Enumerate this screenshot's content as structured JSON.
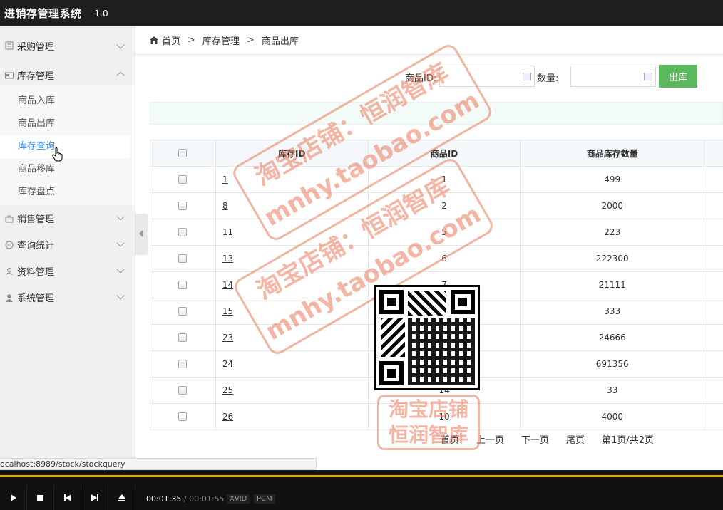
{
  "app": {
    "title": "进销存管理系统",
    "version": "1.0"
  },
  "sidebar": {
    "groups": [
      {
        "label": "采购管理",
        "icon": "doc-icon",
        "expanded": false
      },
      {
        "label": "库存管理",
        "icon": "card-icon",
        "expanded": true,
        "items": [
          {
            "label": "商品入库"
          },
          {
            "label": "商品出库"
          },
          {
            "label": "库存查询",
            "active": true
          },
          {
            "label": "商品移库"
          },
          {
            "label": "库存盘点"
          }
        ]
      },
      {
        "label": "销售管理",
        "icon": "bag-icon",
        "expanded": false
      },
      {
        "label": "查询统计",
        "icon": "chat-icon",
        "expanded": false
      },
      {
        "label": "资料管理",
        "icon": "user-outline-icon",
        "expanded": false
      },
      {
        "label": "系统管理",
        "icon": "user-icon",
        "expanded": false
      }
    ]
  },
  "breadcrumb": {
    "home": "首页",
    "sep": ">",
    "level1": "库存管理",
    "level2": "商品出库"
  },
  "form": {
    "product_id_label": "商品ID:",
    "product_id_value": "",
    "quantity_label": "数量:",
    "quantity_value": "",
    "submit_label": "出库"
  },
  "table": {
    "headers": [
      "库存ID",
      "商品ID",
      "商品库存数量"
    ],
    "rows": [
      {
        "stock_id": "1",
        "product_id": "1",
        "qty": "499"
      },
      {
        "stock_id": "8",
        "product_id": "2",
        "qty": "2000"
      },
      {
        "stock_id": "11",
        "product_id": "5",
        "qty": "223"
      },
      {
        "stock_id": "13",
        "product_id": "6",
        "qty": "222300"
      },
      {
        "stock_id": "14",
        "product_id": "7",
        "qty": "21111"
      },
      {
        "stock_id": "15",
        "product_id": "",
        "qty": "333"
      },
      {
        "stock_id": "23",
        "product_id": "",
        "qty": "24666"
      },
      {
        "stock_id": "24",
        "product_id": "",
        "qty": "691356"
      },
      {
        "stock_id": "25",
        "product_id": "14",
        "qty": "33"
      },
      {
        "stock_id": "26",
        "product_id": "10",
        "qty": "4000"
      }
    ]
  },
  "pager": {
    "first": "首页",
    "prev": "上一页",
    "next": "下一页",
    "last": "尾页",
    "status": "第1页/共2页"
  },
  "statusbar": {
    "url": "ocalhost:8989/stock/stockquery"
  },
  "watermark": {
    "line1": "淘宝店铺：恒润智库",
    "line2": "mnhy.taobao.com",
    "stamp_line1": "淘宝店铺",
    "stamp_line2": "恒润智库"
  },
  "player": {
    "current": "00:01:35",
    "separator": "/",
    "total": "00:01:55",
    "tag1": "XVID",
    "tag2": "PCM"
  },
  "colors": {
    "topbar": "#1f1f1f",
    "accent": "#2e8ded",
    "submit": "#5cb85c",
    "progress": "#d9b200"
  }
}
